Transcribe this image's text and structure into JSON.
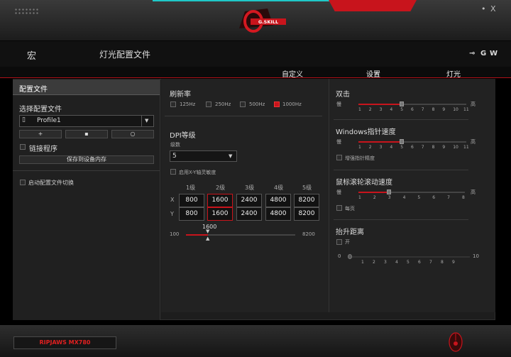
{
  "window": {
    "pin": "•",
    "close": "X"
  },
  "nav": {
    "macro": "宏",
    "lighting_profile": "灯光配置文件",
    "icons": [
      "back-arrow-icon",
      "g-logo-icon",
      "w-logo-icon"
    ],
    "g": "G",
    "w": "W"
  },
  "tabs": {
    "custom": "自定义",
    "settings": "设置",
    "light": "灯光"
  },
  "profile": {
    "header": "配置文件",
    "select_label": "选择配置文件",
    "current": "Profile1",
    "add": "+",
    "delete": "▪",
    "refresh": "○",
    "link_program": "链接程序",
    "save_to_device": "保存到设备内存",
    "enable_switch": "启动配置文件切换"
  },
  "refresh_rate": {
    "title": "刷新率",
    "options": [
      "125Hz",
      "250Hz",
      "500Hz",
      "1000Hz"
    ],
    "selected": "1000Hz"
  },
  "dpi": {
    "title": "DPI等级",
    "level_label": "级数",
    "level_value": "5",
    "xy_label": "启用X-Y轴灵敏度",
    "headers": [
      "1级",
      "2级",
      "3级",
      "4级",
      "5级"
    ],
    "x_label": "X",
    "y_label": "Y",
    "x_values": [
      "800",
      "1600",
      "2400",
      "4800",
      "8200"
    ],
    "y_values": [
      "800",
      "1600",
      "2400",
      "4800",
      "8200"
    ],
    "active_level": 2,
    "slider_value": "1600",
    "slider_min": "100",
    "slider_max": "8200"
  },
  "double_click": {
    "title": "双击",
    "low": "慢",
    "high": "高",
    "ticks": [
      "1",
      "2",
      "3",
      "4",
      "5",
      "6",
      "7",
      "8",
      "9",
      "10",
      "11"
    ],
    "value": 5
  },
  "pointer": {
    "title": "Windows指针速度",
    "low": "慢",
    "high": "高",
    "ticks": [
      "1",
      "2",
      "3",
      "4",
      "5",
      "6",
      "7",
      "8",
      "9",
      "10",
      "11"
    ],
    "value": 5,
    "enhance": "增强指针精度"
  },
  "scroll": {
    "title": "鼠标滚轮滚动速度",
    "low": "慢",
    "high": "高",
    "ticks": [
      "1",
      "2",
      "3",
      "4",
      "5",
      "6",
      "7",
      "8"
    ],
    "value": 3,
    "page": "每页"
  },
  "lift": {
    "title": "抬升距离",
    "on": "开",
    "min": "0",
    "max": "10",
    "ticks": [
      "1",
      "2",
      "3",
      "4",
      "5",
      "6",
      "7",
      "8",
      "9"
    ]
  },
  "footer": {
    "model": "RIPJAWS MX780"
  },
  "colors": {
    "accent": "#c8141c",
    "teal": "#1fc8c8"
  }
}
